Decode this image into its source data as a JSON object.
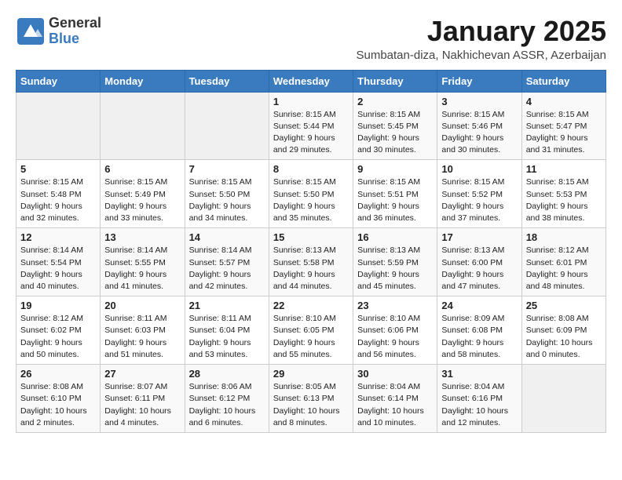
{
  "logo": {
    "general": "General",
    "blue": "Blue"
  },
  "title": "January 2025",
  "location": "Sumbatan-diza, Nakhichevan ASSR, Azerbaijan",
  "weekdays": [
    "Sunday",
    "Monday",
    "Tuesday",
    "Wednesday",
    "Thursday",
    "Friday",
    "Saturday"
  ],
  "weeks": [
    [
      {
        "day": "",
        "info": ""
      },
      {
        "day": "",
        "info": ""
      },
      {
        "day": "",
        "info": ""
      },
      {
        "day": "1",
        "info": "Sunrise: 8:15 AM\nSunset: 5:44 PM\nDaylight: 9 hours\nand 29 minutes."
      },
      {
        "day": "2",
        "info": "Sunrise: 8:15 AM\nSunset: 5:45 PM\nDaylight: 9 hours\nand 30 minutes."
      },
      {
        "day": "3",
        "info": "Sunrise: 8:15 AM\nSunset: 5:46 PM\nDaylight: 9 hours\nand 30 minutes."
      },
      {
        "day": "4",
        "info": "Sunrise: 8:15 AM\nSunset: 5:47 PM\nDaylight: 9 hours\nand 31 minutes."
      }
    ],
    [
      {
        "day": "5",
        "info": "Sunrise: 8:15 AM\nSunset: 5:48 PM\nDaylight: 9 hours\nand 32 minutes."
      },
      {
        "day": "6",
        "info": "Sunrise: 8:15 AM\nSunset: 5:49 PM\nDaylight: 9 hours\nand 33 minutes."
      },
      {
        "day": "7",
        "info": "Sunrise: 8:15 AM\nSunset: 5:50 PM\nDaylight: 9 hours\nand 34 minutes."
      },
      {
        "day": "8",
        "info": "Sunrise: 8:15 AM\nSunset: 5:50 PM\nDaylight: 9 hours\nand 35 minutes."
      },
      {
        "day": "9",
        "info": "Sunrise: 8:15 AM\nSunset: 5:51 PM\nDaylight: 9 hours\nand 36 minutes."
      },
      {
        "day": "10",
        "info": "Sunrise: 8:15 AM\nSunset: 5:52 PM\nDaylight: 9 hours\nand 37 minutes."
      },
      {
        "day": "11",
        "info": "Sunrise: 8:15 AM\nSunset: 5:53 PM\nDaylight: 9 hours\nand 38 minutes."
      }
    ],
    [
      {
        "day": "12",
        "info": "Sunrise: 8:14 AM\nSunset: 5:54 PM\nDaylight: 9 hours\nand 40 minutes."
      },
      {
        "day": "13",
        "info": "Sunrise: 8:14 AM\nSunset: 5:55 PM\nDaylight: 9 hours\nand 41 minutes."
      },
      {
        "day": "14",
        "info": "Sunrise: 8:14 AM\nSunset: 5:57 PM\nDaylight: 9 hours\nand 42 minutes."
      },
      {
        "day": "15",
        "info": "Sunrise: 8:13 AM\nSunset: 5:58 PM\nDaylight: 9 hours\nand 44 minutes."
      },
      {
        "day": "16",
        "info": "Sunrise: 8:13 AM\nSunset: 5:59 PM\nDaylight: 9 hours\nand 45 minutes."
      },
      {
        "day": "17",
        "info": "Sunrise: 8:13 AM\nSunset: 6:00 PM\nDaylight: 9 hours\nand 47 minutes."
      },
      {
        "day": "18",
        "info": "Sunrise: 8:12 AM\nSunset: 6:01 PM\nDaylight: 9 hours\nand 48 minutes."
      }
    ],
    [
      {
        "day": "19",
        "info": "Sunrise: 8:12 AM\nSunset: 6:02 PM\nDaylight: 9 hours\nand 50 minutes."
      },
      {
        "day": "20",
        "info": "Sunrise: 8:11 AM\nSunset: 6:03 PM\nDaylight: 9 hours\nand 51 minutes."
      },
      {
        "day": "21",
        "info": "Sunrise: 8:11 AM\nSunset: 6:04 PM\nDaylight: 9 hours\nand 53 minutes."
      },
      {
        "day": "22",
        "info": "Sunrise: 8:10 AM\nSunset: 6:05 PM\nDaylight: 9 hours\nand 55 minutes."
      },
      {
        "day": "23",
        "info": "Sunrise: 8:10 AM\nSunset: 6:06 PM\nDaylight: 9 hours\nand 56 minutes."
      },
      {
        "day": "24",
        "info": "Sunrise: 8:09 AM\nSunset: 6:08 PM\nDaylight: 9 hours\nand 58 minutes."
      },
      {
        "day": "25",
        "info": "Sunrise: 8:08 AM\nSunset: 6:09 PM\nDaylight: 10 hours\nand 0 minutes."
      }
    ],
    [
      {
        "day": "26",
        "info": "Sunrise: 8:08 AM\nSunset: 6:10 PM\nDaylight: 10 hours\nand 2 minutes."
      },
      {
        "day": "27",
        "info": "Sunrise: 8:07 AM\nSunset: 6:11 PM\nDaylight: 10 hours\nand 4 minutes."
      },
      {
        "day": "28",
        "info": "Sunrise: 8:06 AM\nSunset: 6:12 PM\nDaylight: 10 hours\nand 6 minutes."
      },
      {
        "day": "29",
        "info": "Sunrise: 8:05 AM\nSunset: 6:13 PM\nDaylight: 10 hours\nand 8 minutes."
      },
      {
        "day": "30",
        "info": "Sunrise: 8:04 AM\nSunset: 6:14 PM\nDaylight: 10 hours\nand 10 minutes."
      },
      {
        "day": "31",
        "info": "Sunrise: 8:04 AM\nSunset: 6:16 PM\nDaylight: 10 hours\nand 12 minutes."
      },
      {
        "day": "",
        "info": ""
      }
    ]
  ]
}
